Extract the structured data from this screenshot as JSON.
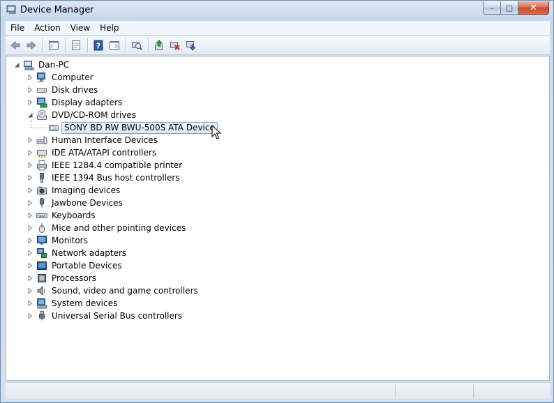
{
  "window": {
    "title": "Device Manager",
    "min_glyph": "–",
    "max_glyph": "□",
    "close_glyph": "✕"
  },
  "menu": [
    "File",
    "Action",
    "View",
    "Help"
  ],
  "toolbar": {
    "buttons": [
      "back-icon",
      "forward-icon",
      "console-tree-icon",
      "properties-icon",
      "help-icon",
      "action-pane-icon",
      "scan-hardware-icon",
      "update-driver-icon",
      "disable-device-icon",
      "uninstall-device-icon"
    ]
  },
  "tree": {
    "root": "Dan-PC",
    "categories": [
      {
        "label": "Computer",
        "icon": "computer-icon"
      },
      {
        "label": "Disk drives",
        "icon": "disk-drive-icon"
      },
      {
        "label": "Display adapters",
        "icon": "display-adapter-icon"
      },
      {
        "label": "DVD/CD-ROM drives",
        "icon": "dvd-drive-icon",
        "expanded": true
      },
      {
        "label": "Human Interface Devices",
        "icon": "hid-icon"
      },
      {
        "label": "IDE ATA/ATAPI controllers",
        "icon": "ide-controller-icon"
      },
      {
        "label": "IEEE 1284.4 compatible printer",
        "icon": "printer-icon"
      },
      {
        "label": "IEEE 1394 Bus host controllers",
        "icon": "firewire-icon"
      },
      {
        "label": "Imaging devices",
        "icon": "camera-icon"
      },
      {
        "label": "Jawbone Devices",
        "icon": "jawbone-icon"
      },
      {
        "label": "Keyboards",
        "icon": "keyboard-icon"
      },
      {
        "label": "Mice and other pointing devices",
        "icon": "mouse-icon"
      },
      {
        "label": "Monitors",
        "icon": "monitor-icon"
      },
      {
        "label": "Network adapters",
        "icon": "network-adapter-icon"
      },
      {
        "label": "Portable Devices",
        "icon": "portable-device-icon"
      },
      {
        "label": "Processors",
        "icon": "processor-icon"
      },
      {
        "label": "Sound, video and game controllers",
        "icon": "sound-icon"
      },
      {
        "label": "System devices",
        "icon": "system-device-icon"
      },
      {
        "label": "Universal Serial Bus controllers",
        "icon": "usb-icon"
      }
    ],
    "dvd_child": "SONY BD RW BWU-500S ATA Device"
  },
  "colors": {
    "selection_border": "#7da2ce",
    "selection_fill": "#d9e8f9",
    "close_red": "#c44a30"
  }
}
